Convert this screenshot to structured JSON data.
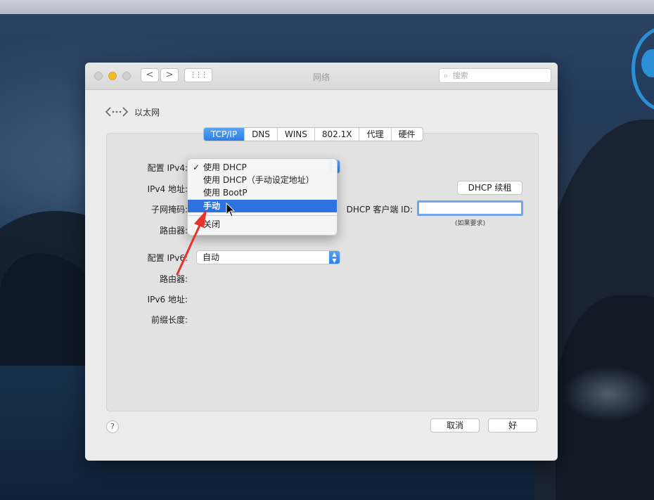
{
  "window": {
    "title": "网络",
    "back_label": "<",
    "forward_label": ">",
    "grid_label": "⋮⋮⋮",
    "search_placeholder": "搜索"
  },
  "breadcrumb": {
    "icon": "network-arrows-icon",
    "label": "以太网"
  },
  "tabs": [
    {
      "label": "TCP/IP",
      "active": true
    },
    {
      "label": "DNS"
    },
    {
      "label": "WINS"
    },
    {
      "label": "802.1X"
    },
    {
      "label": "代理"
    },
    {
      "label": "硬件"
    }
  ],
  "ipv4": {
    "config_label": "配置 IPv4:",
    "address_label": "IPv4 地址:",
    "subnet_label": "子网掩码:",
    "router_label": "路由器:"
  },
  "dhcp": {
    "renew_button": "DHCP 续租",
    "client_id_label": "DHCP 客户端 ID:",
    "client_id_value": "",
    "client_id_hint": "(如果要求)"
  },
  "ipv6": {
    "config_label": "配置 IPv6:",
    "config_value": "自动",
    "router_label": "路由器:",
    "address_label": "IPv6 地址:",
    "prefix_label": "前缀长度:"
  },
  "menu": {
    "checkmark": "✓",
    "items": [
      {
        "label": "使用 DHCP",
        "checked": true
      },
      {
        "label": "使用 DHCP（手动设定地址）"
      },
      {
        "label": "使用 BootP"
      },
      {
        "label": "手动",
        "highlighted": true
      },
      {
        "label": "关闭"
      }
    ]
  },
  "footer": {
    "help": "?",
    "cancel": "取消",
    "ok": "好"
  },
  "colors": {
    "accent": "#2e72e0",
    "traffic_yellow": "#f5b92e",
    "annotation_arrow": "#e8332a"
  }
}
